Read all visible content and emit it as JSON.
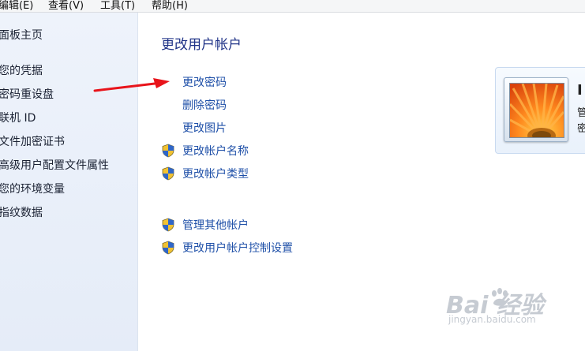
{
  "menu": {
    "items": [
      {
        "label": "编辑(E)"
      },
      {
        "label": "查看(V)"
      },
      {
        "label": "工具(T)"
      },
      {
        "label": "帮助(H)"
      }
    ]
  },
  "sidebar": {
    "items": [
      {
        "label": "面板主页"
      },
      {
        "label": "您的凭据"
      },
      {
        "label": "密码重设盘"
      },
      {
        "label": "联机 ID"
      },
      {
        "label": "文件加密证书"
      },
      {
        "label": "高级用户配置文件属性"
      },
      {
        "label": "您的环境变量"
      },
      {
        "label": "指纹数据"
      }
    ]
  },
  "main": {
    "title": "更改用户帐户",
    "tasks": [
      {
        "label": "更改密码",
        "icon": "none"
      },
      {
        "label": "删除密码",
        "icon": "none"
      },
      {
        "label": "更改图片",
        "icon": "none"
      },
      {
        "label": "更改帐户名称",
        "icon": "uac-shield-icon"
      },
      {
        "label": "更改帐户类型",
        "icon": "uac-shield-icon"
      }
    ],
    "other_tasks": [
      {
        "label": "管理其他帐户",
        "icon": "uac-shield-icon"
      },
      {
        "label": "更改用户帐户控制设置",
        "icon": "uac-shield-icon"
      }
    ]
  },
  "account_card": {
    "name_initial": "I",
    "line2": "管",
    "line3": "密"
  },
  "annotation": {
    "color": "#e8141b"
  },
  "watermark": {
    "logo": "Bai 经验",
    "url": "jingyan.baidu.com"
  }
}
